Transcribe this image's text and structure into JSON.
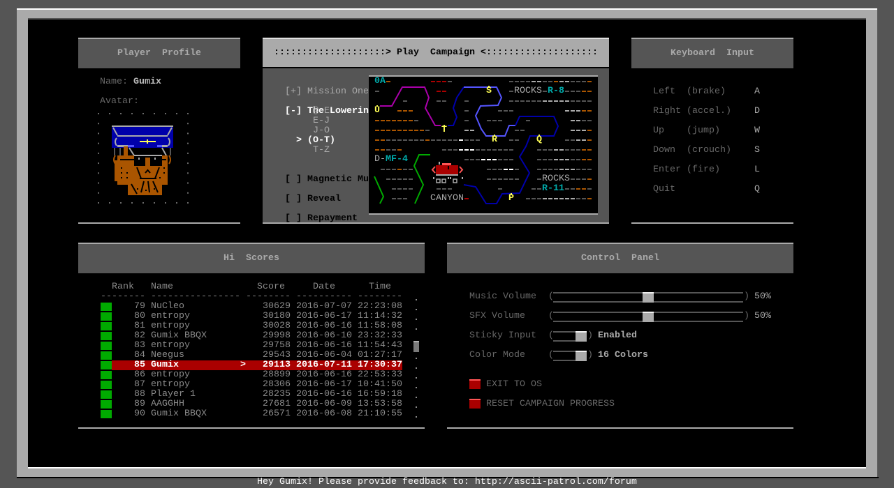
{
  "footer": {
    "message": "Hey Gumix! Please provide feedback to: http://ascii-patrol.com/forum"
  },
  "colors": {
    "rank_badge": "#00aa00",
    "selected_row": "#aa0000",
    "action_button": "#aa0000",
    "checkpoint": "#ffff55",
    "zone_code": "#00aaaa"
  },
  "profile": {
    "title": "Player  Profile",
    "name_label": "Name:",
    "name": "Gumix",
    "avatar_label": "Avatar:"
  },
  "campaign": {
    "title": "::::::::::::::::::::> Play  Campaign <::::::::::::::::::::",
    "missions": [
      {
        "marker": "[+]",
        "name": "Mission One"
      },
      {
        "marker": "[-]",
        "name": "The Lowering"
      },
      {
        "marker": "[ ]",
        "name": "Magnetic Mud"
      },
      {
        "marker": "[ ]",
        "name": "Reveal"
      },
      {
        "marker": "[ ]",
        "name": "Repayment"
      }
    ],
    "segments": [
      "@-E",
      "E-J",
      "J-O",
      "(O-T)",
      "T-Z"
    ],
    "selected_segment": 3,
    "selected_marker": ">",
    "map": {
      "start_zone": "0A",
      "checkpoints": {
        "U": "U",
        "S": "S",
        "T": "T",
        "R": "R",
        "Q": "Q",
        "P": "P"
      },
      "rocks_a": {
        "name": "ROCKS",
        "code": "R-8"
      },
      "zone_d": {
        "name": "D",
        "sep": "-",
        "code": "MF-4"
      },
      "rocks_b": {
        "name": "ROCKS",
        "code": "R-11"
      },
      "canyon": "CANYON"
    }
  },
  "keyboard": {
    "title": "Keyboard  Input",
    "bindings": [
      {
        "action": "Left",
        "hint": "(brake)",
        "key": "A"
      },
      {
        "action": "Right",
        "hint": "(accel.)",
        "key": "D"
      },
      {
        "action": "Up",
        "hint": "(jump)",
        "key": "W"
      },
      {
        "action": "Down",
        "hint": "(crouch)",
        "key": "S"
      },
      {
        "action": "Enter",
        "hint": "(fire)",
        "key": "L"
      },
      {
        "action": "Quit",
        "hint": "",
        "key": "Q"
      }
    ]
  },
  "hiscores": {
    "title": "Hi  Scores",
    "columns": {
      "rank": "Rank",
      "name": "Name",
      "score": "Score",
      "date": "Date",
      "time": "Time"
    },
    "separators": [
      "--------",
      "----------------",
      "--------",
      "----------",
      "--------"
    ],
    "rows": [
      {
        "rank": 79,
        "name": "NuCleo",
        "score": 30629,
        "date": "2016-07-07",
        "time": "22:23:08"
      },
      {
        "rank": 80,
        "name": "entropy",
        "score": 30180,
        "date": "2016-06-17",
        "time": "11:14:32"
      },
      {
        "rank": 81,
        "name": "entropy",
        "score": 30028,
        "date": "2016-06-16",
        "time": "11:58:08"
      },
      {
        "rank": 82,
        "name": "Gumix BBQX",
        "score": 29998,
        "date": "2016-06-10",
        "time": "23:32:33"
      },
      {
        "rank": 83,
        "name": "entropy",
        "score": 29758,
        "date": "2016-06-16",
        "time": "11:54:43"
      },
      {
        "rank": 84,
        "name": "Neegus",
        "score": 29543,
        "date": "2016-06-04",
        "time": "01:27:17"
      },
      {
        "rank": 85,
        "name": "Gumix",
        "score": 29113,
        "date": "2016-07-11",
        "time": "17:30:37"
      },
      {
        "rank": 86,
        "name": "entropy",
        "score": 28899,
        "date": "2016-06-16",
        "time": "22:53:33"
      },
      {
        "rank": 87,
        "name": "entropy",
        "score": 28306,
        "date": "2016-06-17",
        "time": "10:41:50"
      },
      {
        "rank": 88,
        "name": "Player 1",
        "score": 28235,
        "date": "2016-06-16",
        "time": "16:59:18"
      },
      {
        "rank": 89,
        "name": "AAGGHH",
        "score": 27681,
        "date": "2016-06-09",
        "time": "13:53:58"
      },
      {
        "rank": 90,
        "name": "Gumix BBQX",
        "score": 26571,
        "date": "2016-06-08",
        "time": "21:10:55"
      }
    ],
    "selected_index": 6,
    "selected_marker": ">",
    "scroll_position": 0.42
  },
  "control": {
    "title": "Control  Panel",
    "sliders": [
      {
        "label": "Music Volume",
        "value": 50,
        "display": "50%"
      },
      {
        "label": "SFX Volume",
        "value": 50,
        "display": "50%"
      }
    ],
    "toggles": [
      {
        "label": "Sticky Input",
        "on": true,
        "display": "Enabled"
      },
      {
        "label": "Color Mode",
        "on": true,
        "display": "16 Colors"
      }
    ],
    "actions": [
      {
        "label": "EXIT TO OS"
      },
      {
        "label": "RESET CAMPAIGN PROGRESS"
      }
    ]
  }
}
